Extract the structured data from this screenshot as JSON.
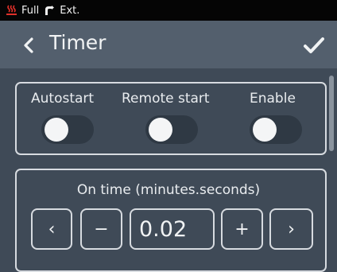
{
  "status": {
    "mode": "Full",
    "ext": "Ext.",
    "colors": {
      "heater": "#e0302a",
      "bar": "#050505"
    }
  },
  "header": {
    "title": "Timer",
    "back_icon": "chevron-left-icon",
    "confirm_icon": "check-icon"
  },
  "modes": [
    {
      "label": "Autostart",
      "enabled": false
    },
    {
      "label": "Remote start",
      "enabled": false
    },
    {
      "label": "Enable",
      "enabled": false
    }
  ],
  "on_time": {
    "title": "On time (minutes.seconds)",
    "value": "0.02",
    "buttons": {
      "prev": "‹",
      "minus": "−",
      "plus": "+",
      "next": "›"
    }
  }
}
